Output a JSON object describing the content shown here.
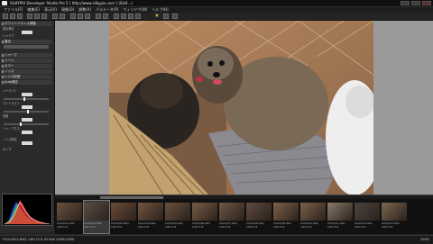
{
  "window": {
    "title": "SILKYPIX Developer Studio Pro 5  [ http://www.silkypix.com ]  (SILK...)"
  },
  "menu": [
    "ファイル(F)",
    "編集(E)",
    "表示(V)",
    "現像(D)",
    "調整(A)",
    "パラメータ(P)",
    "ウィンドウ(W)",
    "ヘルプ(H)"
  ],
  "left_panel": {
    "sections": [
      {
        "label": "ホワイトバランス調整"
      },
      {
        "label": "露出"
      },
      {
        "label": "シャープ"
      },
      {
        "label": "トーン"
      },
      {
        "label": "カラー"
      },
      {
        "label": "ノイズ"
      },
      {
        "label": "レンズ収差"
      },
      {
        "label": "Auto補正"
      }
    ],
    "rows": [
      {
        "label": "露出補正"
      },
      {
        "label": "シャドウ"
      },
      {
        "label": "ハイライト"
      },
      {
        "label": "コントラスト"
      },
      {
        "label": "彩度"
      },
      {
        "label": "シャープネス"
      },
      {
        "label": "ノイズ除去"
      },
      {
        "label": "ガンマ"
      }
    ]
  },
  "filmstrip": {
    "thumbnails": [
      {
        "name": "P1010001.RW2",
        "line2": "1/60 F2.8",
        "color": "#6a5140",
        "selected": false
      },
      {
        "name": "P1010002.RW2",
        "line2": "1/60 F2.8",
        "color": "#5a4c42",
        "selected": true
      },
      {
        "name": "P1010003.RW2",
        "line2": "1/60 F2.8",
        "color": "#6b4b38",
        "selected": false
      },
      {
        "name": "P1010004.RW2",
        "line2": "1/60 F2.8",
        "color": "#735440",
        "selected": false
      },
      {
        "name": "P1010005.RW2",
        "line2": "1/60 F2.8",
        "color": "#6a4f3e",
        "selected": false
      },
      {
        "name": "P1010006.RW2",
        "line2": "1/60 F2.8",
        "color": "#7a5c46",
        "selected": false
      },
      {
        "name": "P1010007.RW2",
        "line2": "1/60 F2.8",
        "color": "#6e5644",
        "selected": false
      },
      {
        "name": "P1010008.RW2",
        "line2": "1/60 F2.8",
        "color": "#5f4a3d",
        "selected": false
      },
      {
        "name": "P1010009.RW2",
        "line2": "1/60 F2.8",
        "color": "#806048",
        "selected": false
      },
      {
        "name": "P1010010.RW2",
        "line2": "1/60 F2.8",
        "color": "#7b6049",
        "selected": false
      },
      {
        "name": "P1010011.RW2",
        "line2": "1/60 F2.8",
        "color": "#8a7a6a",
        "selected": false
      },
      {
        "name": "P1010012.RW2",
        "line2": "1/60 F2.8",
        "color": "#4a4440",
        "selected": false
      },
      {
        "name": "P1010013.RW2",
        "line2": "1/60 F2.8",
        "color": "#7d6550",
        "selected": false
      }
    ]
  },
  "status": {
    "left": "P1010002.RW2   1/60  F2.8  ISO400  4000x3000",
    "right": "100%"
  },
  "colors": {
    "accent": "#d4b23a",
    "viewer_bg": "#9a9a9a"
  }
}
